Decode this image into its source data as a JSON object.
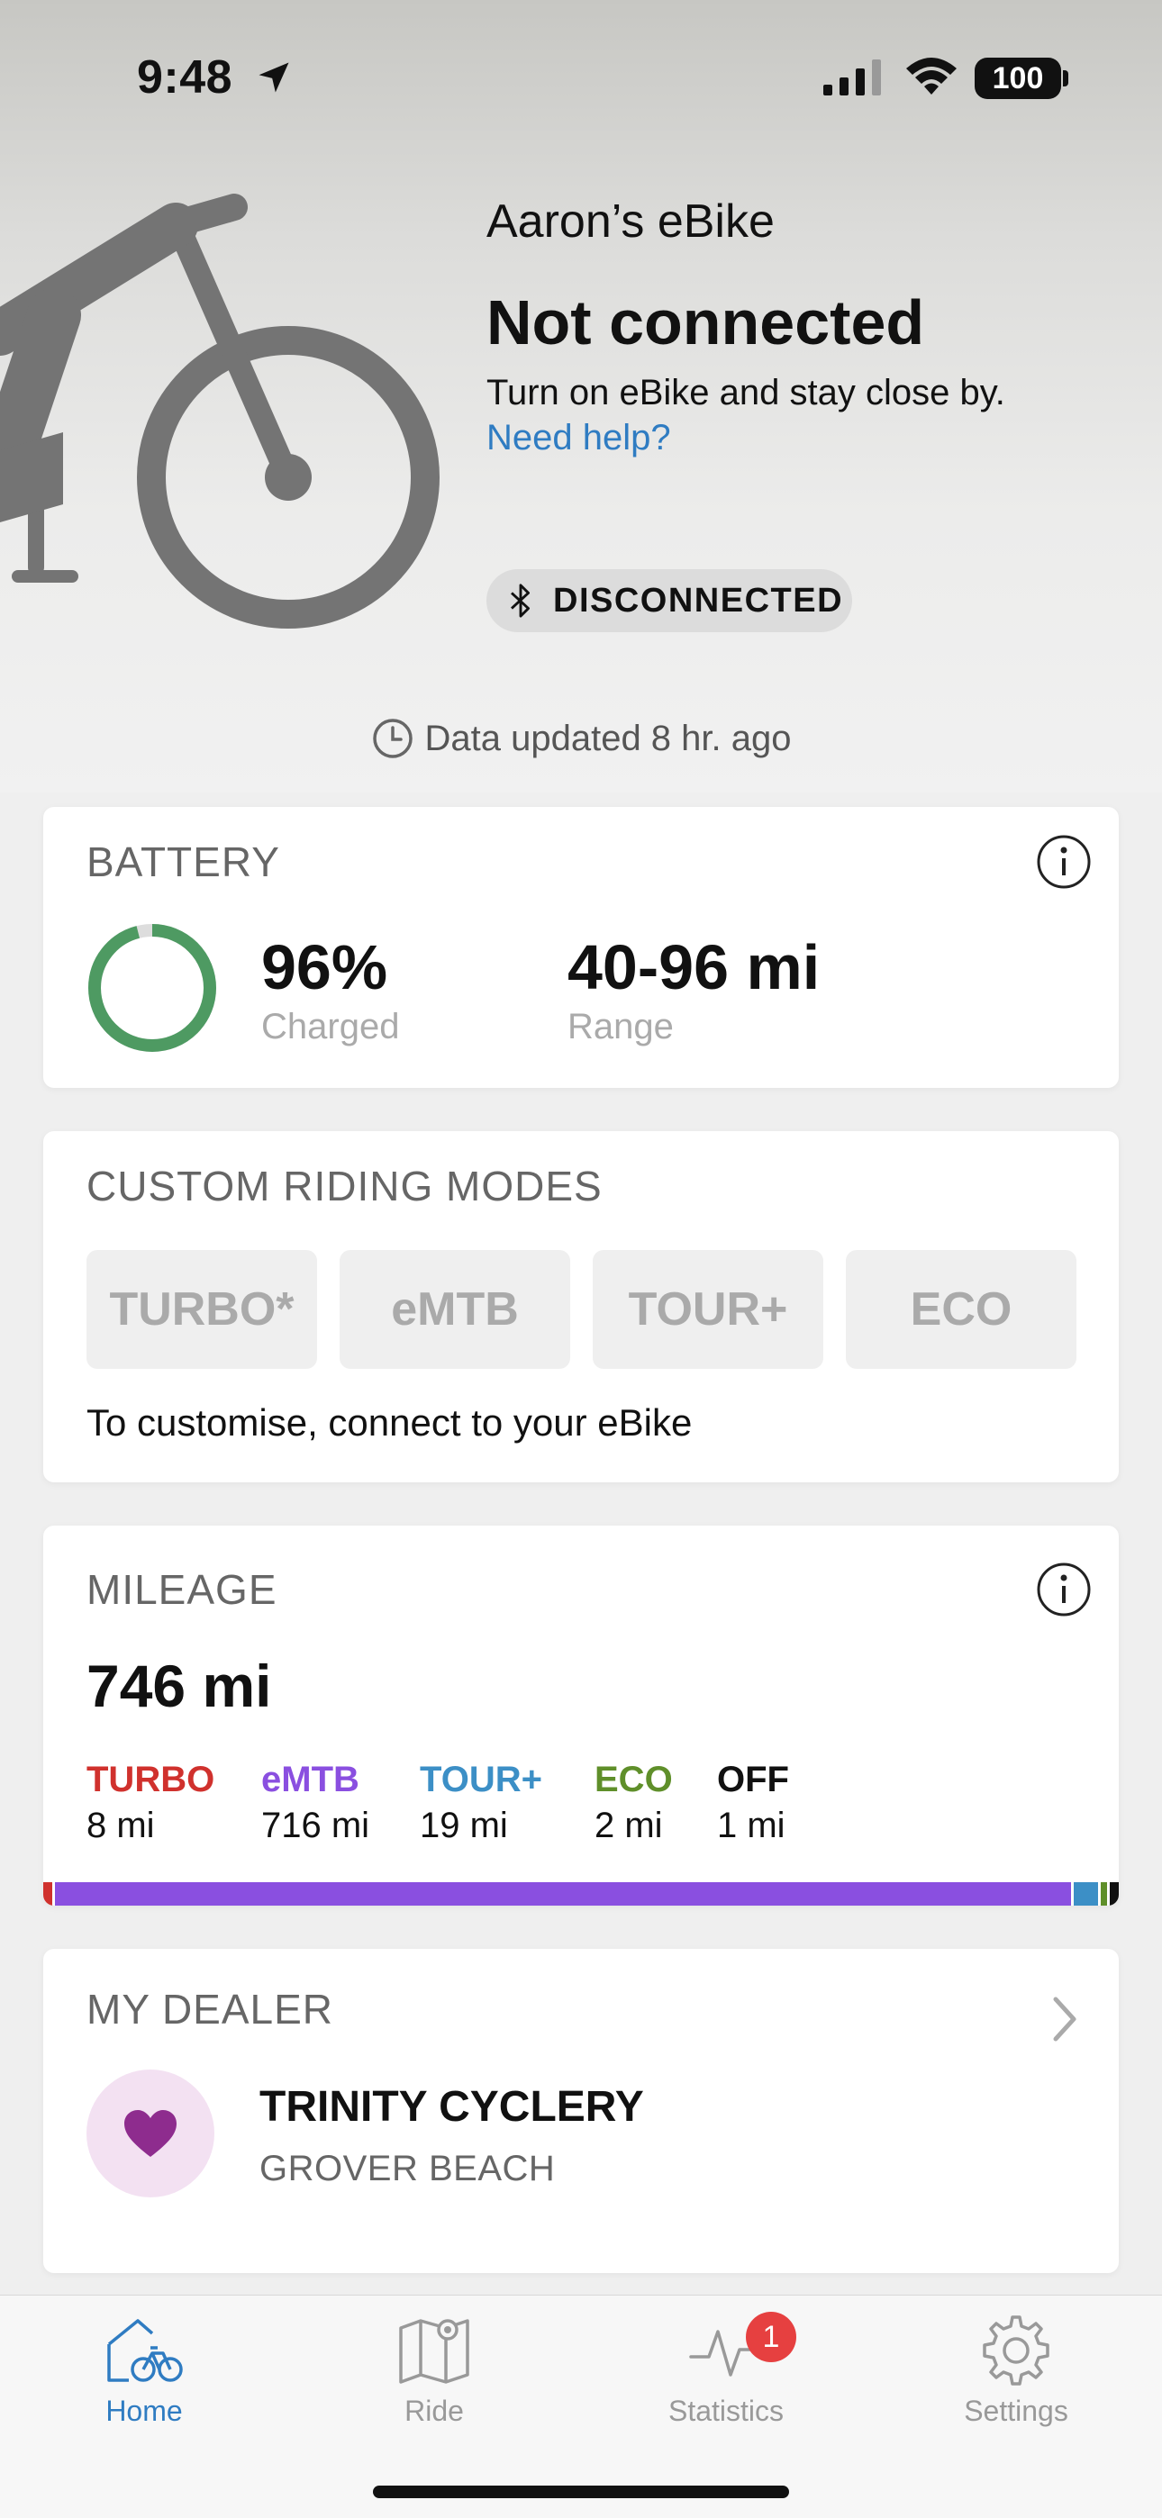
{
  "status_bar": {
    "time": "9:48",
    "battery": "100"
  },
  "bike": {
    "name": "Aaron’s eBike",
    "connection_title": "Not connected",
    "connection_subtitle": "Turn on eBike and stay close by.",
    "help_link": "Need help?",
    "status_badge": "DISCONNECTED"
  },
  "data_updated": "Data updated 8 hr. ago",
  "battery": {
    "title": "BATTERY",
    "percent": "96%",
    "percent_label": "Charged",
    "range": "40-96 mi",
    "range_label": "Range",
    "charge_level": 0.96
  },
  "riding_modes": {
    "title": "CUSTOM RIDING MODES",
    "modes": [
      "TURBO*",
      "eMTB",
      "TOUR+",
      "ECO"
    ],
    "hint": "To customise, connect to your eBike"
  },
  "mileage": {
    "title": "MILEAGE",
    "total": "746 mi",
    "modes": [
      {
        "name": "TURBO",
        "distance": "8 mi",
        "miles": 8,
        "color": "#d0312d"
      },
      {
        "name": "eMTB",
        "distance": "716 mi",
        "miles": 716,
        "color": "#8a4fe0"
      },
      {
        "name": "TOUR+",
        "distance": "19 mi",
        "miles": 19,
        "color": "#3c8fc6"
      },
      {
        "name": "ECO",
        "distance": "2 mi",
        "miles": 2,
        "color": "#5f8f2a"
      },
      {
        "name": "OFF",
        "distance": "1 mi",
        "miles": 1,
        "color": "#111111"
      }
    ]
  },
  "dealer": {
    "title": "MY DEALER",
    "name": "TRINITY CYCLERY",
    "location": "GROVER BEACH"
  },
  "tabs": [
    {
      "label": "Home",
      "icon": "home-bike-icon",
      "active": true
    },
    {
      "label": "Ride",
      "icon": "map-icon",
      "active": false
    },
    {
      "label": "Statistics",
      "icon": "activity-icon",
      "active": false,
      "badge": "1"
    },
    {
      "label": "Settings",
      "icon": "gear-icon",
      "active": false
    }
  ],
  "colors": {
    "accent": "#2f7cc2",
    "battery_ring": "#4e9a62",
    "badge": "#e64040",
    "heart": "#8e2c8e"
  }
}
